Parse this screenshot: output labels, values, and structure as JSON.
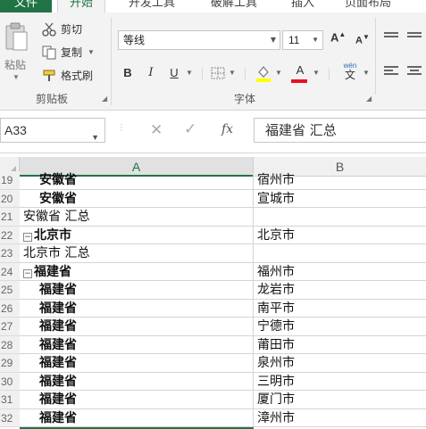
{
  "ribbon_tabs": {
    "file": "文件",
    "home": "开始",
    "developer": "开发工具",
    "crack": "破解工具",
    "insert": "插入",
    "page_layout": "页面布局"
  },
  "clipboard": {
    "paste": "粘贴",
    "cut": "剪切",
    "copy": "复制",
    "format_painter": "格式刷",
    "group_label": "剪贴板"
  },
  "font": {
    "name": "等线",
    "size": "11",
    "bold": "B",
    "italic": "I",
    "underline": "U",
    "grow": "A",
    "shrink": "A",
    "font_color_letter": "A",
    "phonetic_top": "wén",
    "phonetic_bottom": "文",
    "group_label": "字体"
  },
  "formula_bar": {
    "name_box": "A33",
    "cancel": "✕",
    "enter": "✓",
    "fx": "fx",
    "content": "福建省 汇总"
  },
  "columns": [
    "A",
    "B"
  ],
  "rows": [
    {
      "num": "19",
      "a": "安徽省",
      "b": "宿州市",
      "kind": "item"
    },
    {
      "num": "20",
      "a": "安徽省",
      "b": "宣城市",
      "kind": "item"
    },
    {
      "num": "21",
      "a": "安徽省 汇总",
      "b": "",
      "kind": "total"
    },
    {
      "num": "22",
      "a": "北京市",
      "b": "北京市",
      "kind": "group"
    },
    {
      "num": "23",
      "a": "北京市 汇总",
      "b": "",
      "kind": "total"
    },
    {
      "num": "24",
      "a": "福建省",
      "b": "福州市",
      "kind": "group"
    },
    {
      "num": "25",
      "a": "福建省",
      "b": "龙岩市",
      "kind": "item"
    },
    {
      "num": "26",
      "a": "福建省",
      "b": "南平市",
      "kind": "item"
    },
    {
      "num": "27",
      "a": "福建省",
      "b": "宁德市",
      "kind": "item"
    },
    {
      "num": "28",
      "a": "福建省",
      "b": "莆田市",
      "kind": "item"
    },
    {
      "num": "29",
      "a": "福建省",
      "b": "泉州市",
      "kind": "item"
    },
    {
      "num": "30",
      "a": "福建省",
      "b": "三明市",
      "kind": "item"
    },
    {
      "num": "31",
      "a": "福建省",
      "b": "厦门市",
      "kind": "item"
    },
    {
      "num": "32",
      "a": "福建省",
      "b": "漳州市",
      "kind": "item"
    }
  ],
  "colors": {
    "accent": "#217346",
    "ribbon_bg": "#f3f3f3",
    "font_color_underline": "#e81123",
    "highlight_underline": "#ffff00"
  }
}
